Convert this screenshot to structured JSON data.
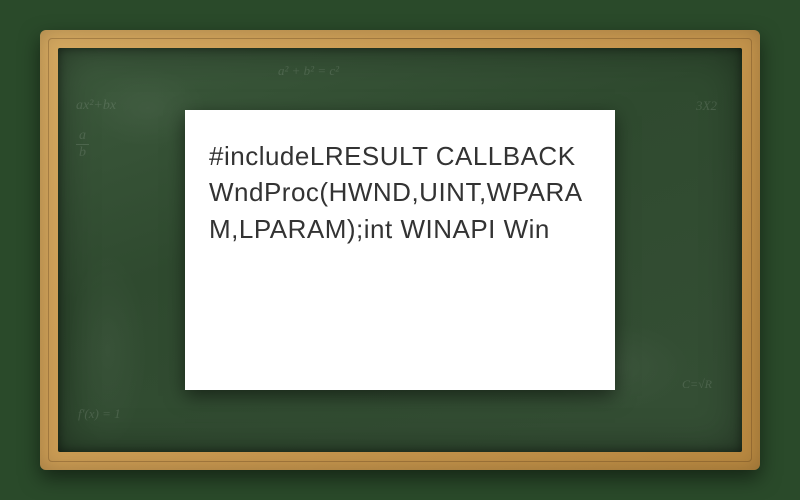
{
  "paper": {
    "code_text": "#includeLRESULT CALLBACK WndProc(HWND,UINT,WPARAM,LPARAM);int WINAPI Win"
  },
  "chalk_formulas": {
    "f1": "ax²+bx",
    "f1b_top": "a",
    "f1b_bot": "b",
    "f2": "a² + b² = c²",
    "f3": "f'(x) = 1",
    "f4": "3X2",
    "f5": "C=√R"
  }
}
